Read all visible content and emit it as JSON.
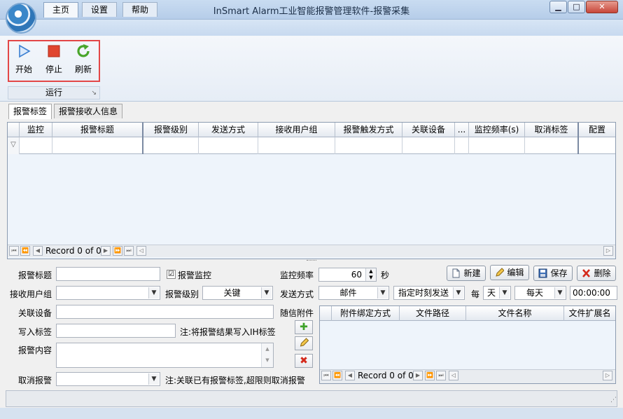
{
  "window": {
    "title": "InSmart Alarm工业智能报警管理软件-报警采集",
    "minimize": "▁",
    "maximize": "□",
    "close": "✕"
  },
  "ribbon": {
    "tabs": [
      "主页",
      "设置",
      "帮助"
    ],
    "group_label": "运行",
    "buttons": {
      "start": "开始",
      "stop": "停止",
      "refresh": "刷新"
    }
  },
  "content_tabs": [
    "报警标签",
    "报警接收人信息"
  ],
  "grid": {
    "columns": [
      "监控",
      "报警标题",
      "报警级别",
      "发送方式",
      "接收用户组",
      "报警触发方式",
      "关联设备",
      "...",
      "监控频率(s)",
      "取消标签",
      "配置"
    ],
    "nav_text": "Record 0 of 0"
  },
  "form": {
    "alarm_title_label": "报警标题",
    "alarm_title_value": "",
    "alarm_monitor_label": "报警监控",
    "alarm_monitor_checked": "☑",
    "monitor_freq_label": "监控频率",
    "monitor_freq_value": "60",
    "monitor_freq_unit": "秒",
    "recv_group_label": "接收用户组",
    "alarm_level_label": "报警级别",
    "alarm_level_value": "关键",
    "send_method_label": "发送方式",
    "send_method_value": "邮件",
    "schedule_value": "指定时刻发送",
    "every_label": "每",
    "day_unit_value": "天",
    "every_day_value": "每天",
    "time_value": "00:00:00",
    "related_device_label": "关联设备",
    "attachment_label": "随信附件",
    "write_tag_label": "写入标签",
    "write_tag_note": "注:将报警结果写入IH标签",
    "alarm_content_label": "报警内容",
    "cancel_alarm_label": "取消报警",
    "cancel_note": "注:关联已有报警标签,超限则取消报警"
  },
  "actions": {
    "new": "新建",
    "edit": "编辑",
    "save": "保存",
    "delete": "删除"
  },
  "attach_grid": {
    "columns": [
      "附件绑定方式",
      "文件路径",
      "文件名称",
      "文件扩展名"
    ],
    "nav_text": "Record 0 of 0"
  },
  "colors": {
    "accent_red": "#e34747",
    "ribbon_blue": "#c7d9ef",
    "grid_bg": "#eef4fb"
  }
}
